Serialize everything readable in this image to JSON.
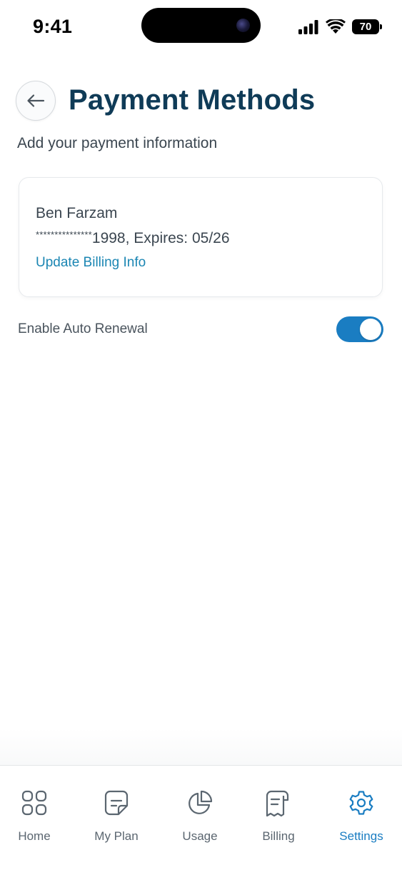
{
  "status_bar": {
    "time": "9:41",
    "battery": "70"
  },
  "header": {
    "title": "Payment Methods",
    "subtitle": "Add your payment information"
  },
  "payment_card": {
    "name": "Ben Farzam",
    "masked_digits": "***************",
    "card_info": "1998, Expires: 05/26",
    "update_link": "Update Billing Info"
  },
  "auto_renewal": {
    "label": "Enable Auto Renewal",
    "enabled": true
  },
  "colors": {
    "title": "#0f3b57",
    "accent": "#1a7dc2",
    "link": "#1b86b3"
  },
  "bottom_nav": {
    "items": [
      {
        "label": "Home",
        "icon": "home-grid-icon"
      },
      {
        "label": "My Plan",
        "icon": "plan-document-icon"
      },
      {
        "label": "Usage",
        "icon": "usage-pie-icon"
      },
      {
        "label": "Billing",
        "icon": "billing-receipt-icon"
      },
      {
        "label": "Settings",
        "icon": "gear-icon",
        "active": true
      }
    ]
  }
}
